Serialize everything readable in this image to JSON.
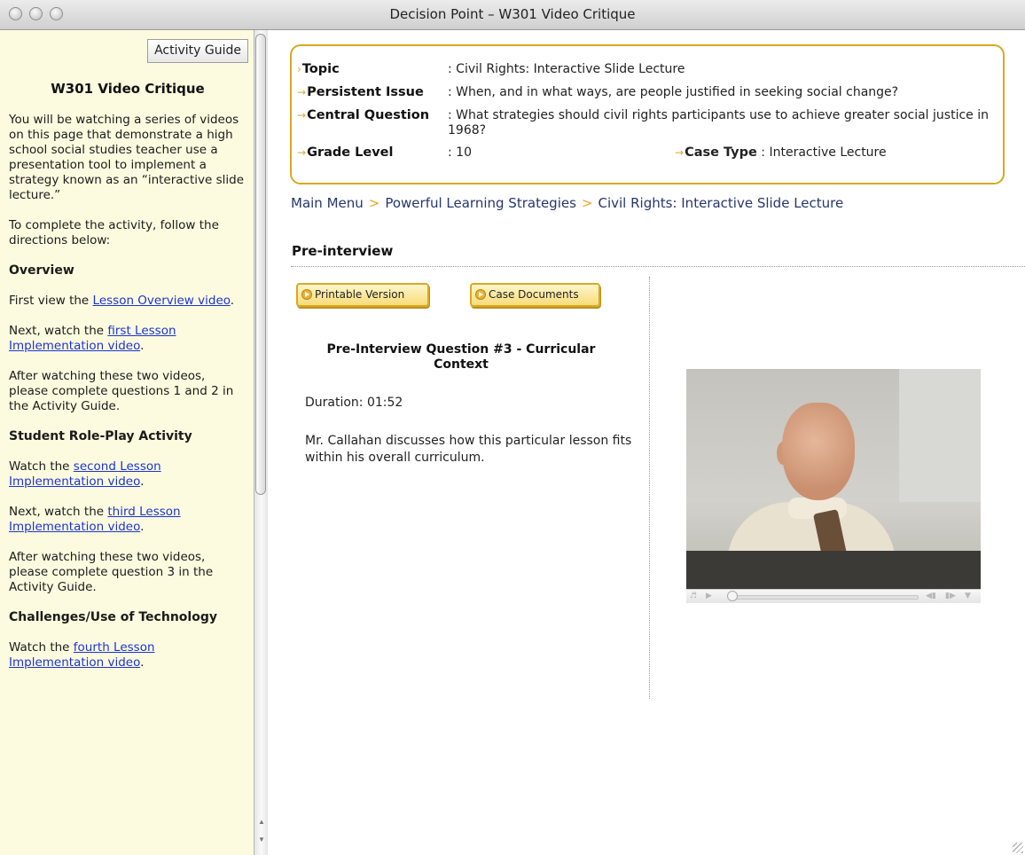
{
  "window": {
    "title": "Decision Point – W301 Video Critique"
  },
  "sidebar": {
    "activity_guide_label": "Activity Guide",
    "title": "W301 Video Critique",
    "intro": "You will be watching a series of videos on this page that demonstrate a high school social studies teacher use a presentation tool to implement a strategy known as an “interactive slide lecture.”",
    "directions": "To complete the activity, follow the directions below:",
    "overview_heading": "Overview",
    "overview_p1_pre": "First view the ",
    "overview_p1_link": "Lesson Overview video",
    "overview_p1_post": ".",
    "overview_p2_pre": "Next, watch the ",
    "overview_p2_link": "first Lesson Implementation video",
    "overview_p2_post": ".",
    "overview_p3": "After watching these two videos, please complete questions 1 and 2 in the Activity Guide.",
    "roleplay_heading": "Student Role-Play Activity",
    "roleplay_p1_pre": "Watch the ",
    "roleplay_p1_link": "second Lesson Implementation video",
    "roleplay_p1_post": ".",
    "roleplay_p2_pre": "Next, watch the ",
    "roleplay_p2_link": "third Lesson Implementation video",
    "roleplay_p2_post": ".",
    "roleplay_p3": "After watching these two videos, please complete question 3 in the Activity Guide.",
    "challenges_heading": "Challenges/Use of Technology",
    "challenges_p1_pre": "Watch the ",
    "challenges_p1_link": "fourth Lesson Implementation video",
    "challenges_p1_post": "."
  },
  "info": {
    "topic_label": "Topic",
    "topic_value": ": Civil Rights: Interactive Slide Lecture",
    "issue_label": "Persistent Issue",
    "issue_value": ": When, and in what ways, are people justified in seeking social change?",
    "question_label": "Central Question",
    "question_value": ": What strategies should civil rights participants use to achieve greater social justice in 1968?",
    "grade_label": "Grade Level",
    "grade_value": ": 10",
    "case_type_label": "Case Type",
    "case_type_value": " : Interactive Lecture"
  },
  "breadcrumb": {
    "items": [
      "Main Menu",
      "Powerful Learning Strategies",
      "Civil Rights: Interactive Slide Lecture"
    ],
    "separator": ">"
  },
  "section": {
    "title": "Pre-interview"
  },
  "buttons": {
    "printable": "Printable Version",
    "documents": "Case Documents"
  },
  "question": {
    "title": "Pre-Interview Question #3 - Curricular Context",
    "duration": "Duration: 01:52",
    "description": "Mr. Callahan discusses how this particular lesson fits within his overall curriculum."
  },
  "video": {
    "progress": 0.0
  }
}
